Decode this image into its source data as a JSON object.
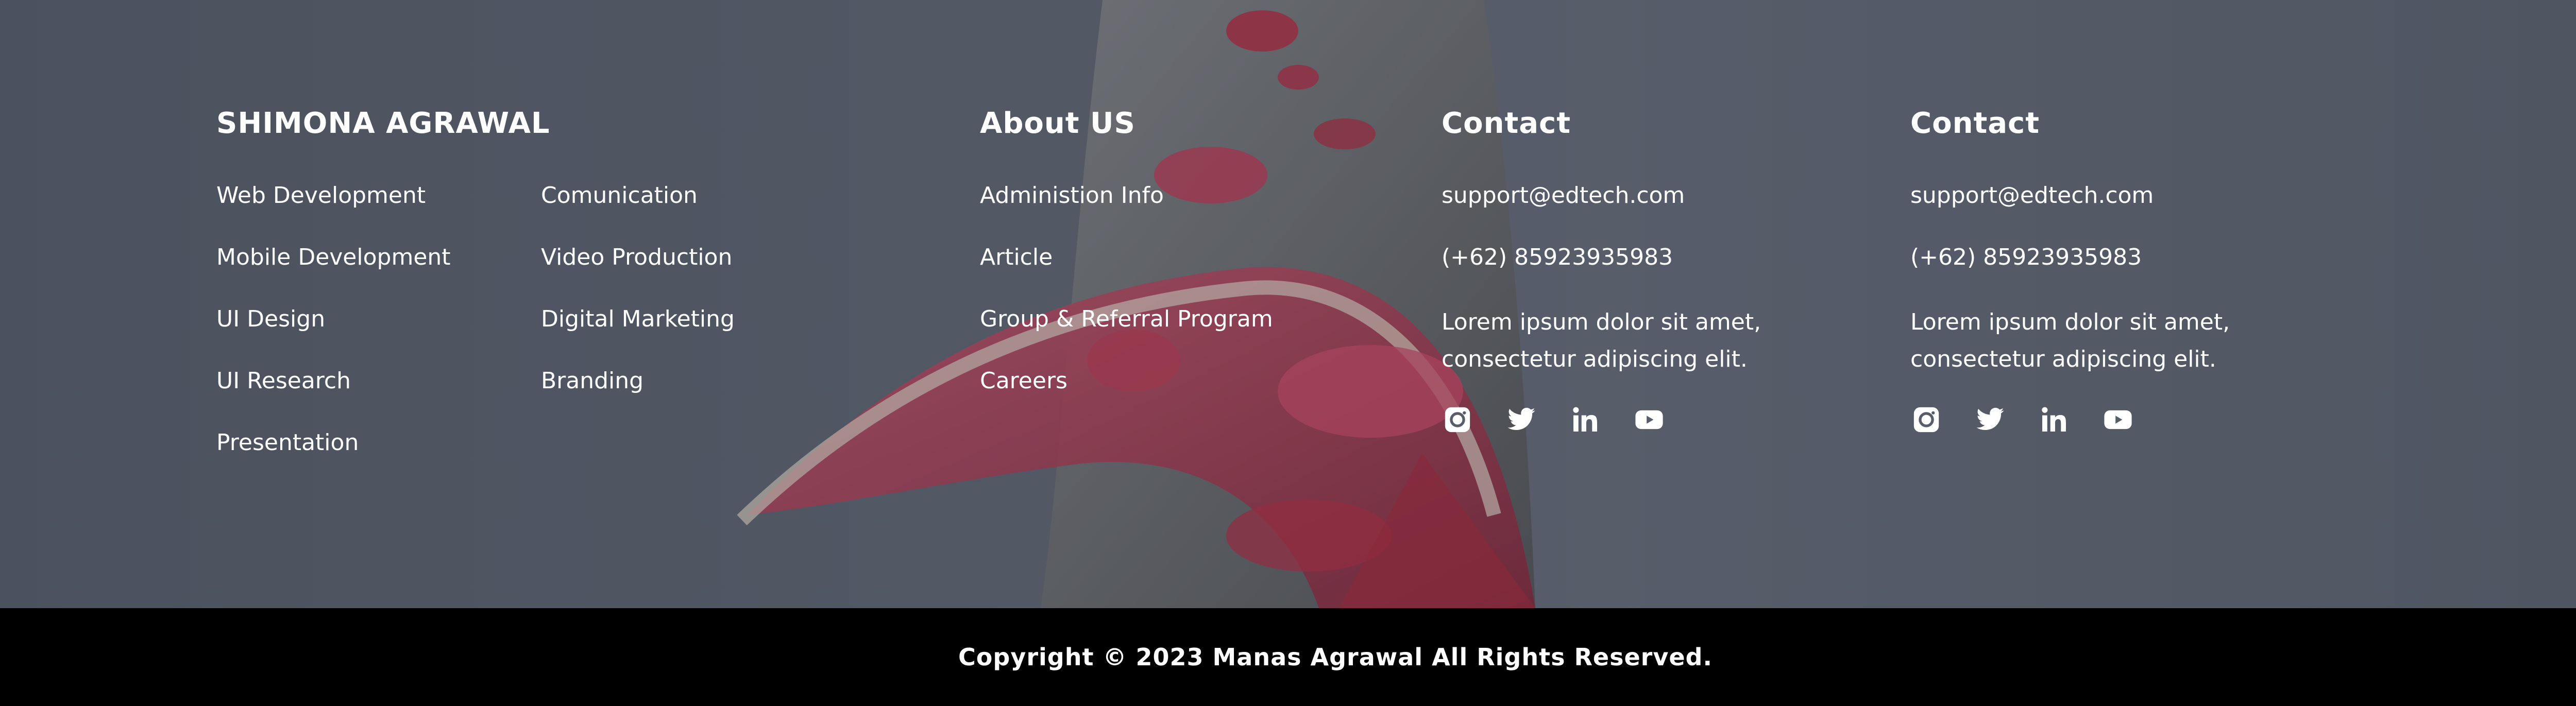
{
  "colors": {
    "footer_overlay": "#575e6a",
    "copyright_bg": "#000000",
    "text": "#ffffff",
    "accent_red": "#b2324a"
  },
  "brand": {
    "title": "SHIMONA AGRAWAL",
    "links_col1": [
      "Web Development",
      "Mobile Development",
      "UI Design",
      "UI Research",
      "Presentation"
    ],
    "links_col2": [
      "Comunication",
      "Video Production",
      "Digital Marketing",
      "Branding"
    ]
  },
  "about": {
    "title": "About US",
    "links": [
      "Administion Info",
      "Article",
      "Group & Referral Program",
      "Careers"
    ]
  },
  "contact_1": {
    "title": "Contact",
    "email": "support@edtech.com",
    "phone": "(+62) 85923935983",
    "address": "Lorem ipsum dolor sit amet, consectetur adipiscing elit.",
    "social": [
      "instagram-icon",
      "twitter-icon",
      "linkedin-icon",
      "youtube-icon"
    ]
  },
  "contact_2": {
    "title": "Contact",
    "email": "support@edtech.com",
    "phone": "(+62) 85923935983",
    "address": "Lorem ipsum dolor sit amet, consectetur adipiscing elit.",
    "social": [
      "instagram-icon",
      "twitter-icon",
      "linkedin-icon",
      "youtube-icon"
    ]
  },
  "copyright": "Copyright © 2023 Manas Agrawal All Rights Reserved."
}
